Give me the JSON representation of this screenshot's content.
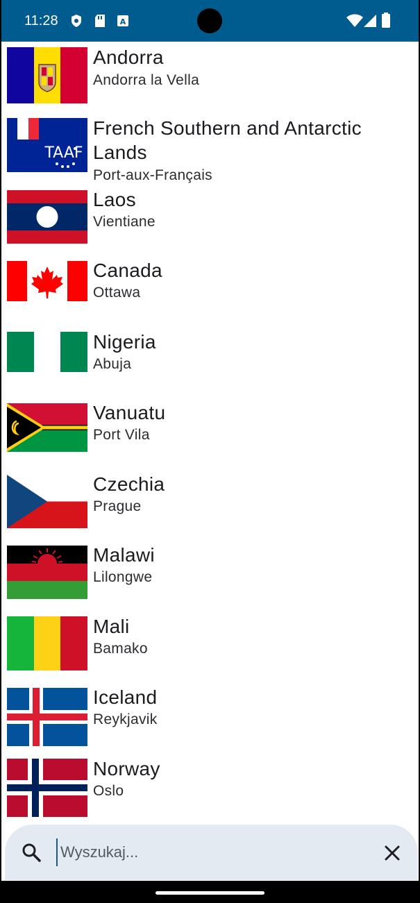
{
  "status_bar": {
    "time": "11:28",
    "background_color": "#005b8f"
  },
  "countries": [
    {
      "name": "Andorra",
      "capital": "Andorra la Vella",
      "flag_icon": "andorra-flag"
    },
    {
      "name": "French Southern and Antarctic Lands",
      "capital": "Port-aux-Français",
      "flag_icon": "french-southern-lands-flag"
    },
    {
      "name": "Laos",
      "capital": "Vientiane",
      "flag_icon": "laos-flag"
    },
    {
      "name": "Canada",
      "capital": "Ottawa",
      "flag_icon": "canada-flag"
    },
    {
      "name": "Nigeria",
      "capital": "Abuja",
      "flag_icon": "nigeria-flag"
    },
    {
      "name": "Vanuatu",
      "capital": "Port Vila",
      "flag_icon": "vanuatu-flag"
    },
    {
      "name": "Czechia",
      "capital": "Prague",
      "flag_icon": "czechia-flag"
    },
    {
      "name": "Malawi",
      "capital": "Lilongwe",
      "flag_icon": "malawi-flag"
    },
    {
      "name": "Mali",
      "capital": "Bamako",
      "flag_icon": "mali-flag"
    },
    {
      "name": "Iceland",
      "capital": "Reykjavik",
      "flag_icon": "iceland-flag"
    },
    {
      "name": "Norway",
      "capital": "Oslo",
      "flag_icon": "norway-flag"
    }
  ],
  "search": {
    "placeholder": "Wyszukaj...",
    "value": ""
  }
}
